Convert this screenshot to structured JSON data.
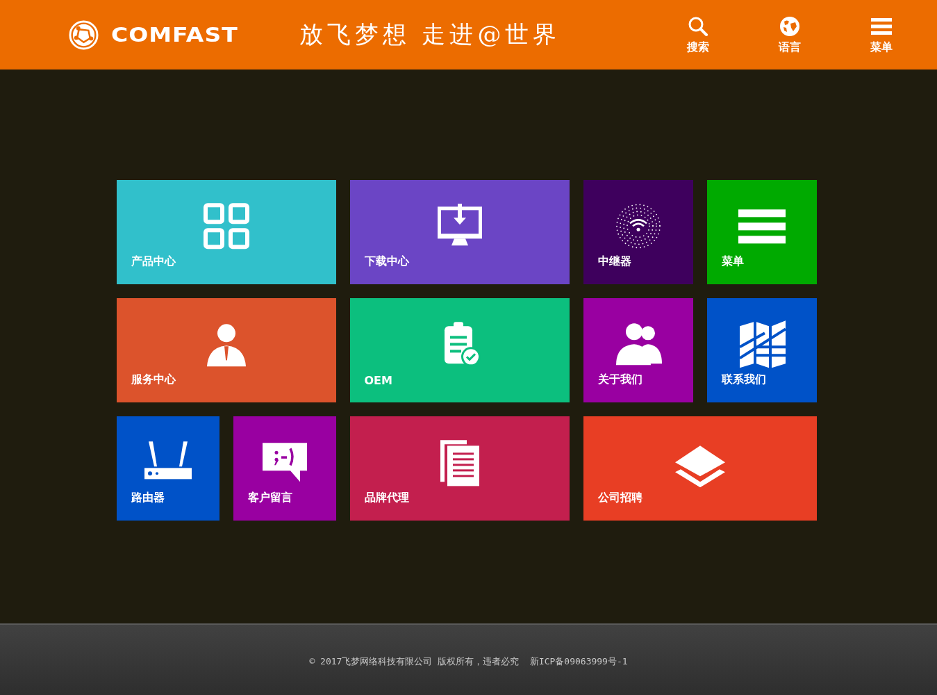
{
  "header": {
    "brand": "COMFAST",
    "slogan": "放飞梦想 走进@世界",
    "nav": [
      {
        "label": "搜索"
      },
      {
        "label": "语言"
      },
      {
        "label": "菜单"
      }
    ]
  },
  "tiles": [
    {
      "label": "产品中心",
      "kind": "wide",
      "color": "#31c0cb"
    },
    {
      "label": "下载中心",
      "kind": "wide",
      "color": "#6b45c5"
    },
    {
      "label": "中继器",
      "kind": "small",
      "color": "#3e005d"
    },
    {
      "label": "菜单",
      "kind": "small",
      "color": "#00aa00"
    },
    {
      "label": "服务中心",
      "kind": "wide",
      "color": "#dc532c"
    },
    {
      "label": "OEM",
      "kind": "wide",
      "color": "#0cbf7e"
    },
    {
      "label": "关于我们",
      "kind": "small",
      "color": "#9900a1"
    },
    {
      "label": "联系我们",
      "kind": "small",
      "color": "#0052c8"
    },
    {
      "label": "路由器",
      "kind": "small",
      "color": "#0052c8"
    },
    {
      "label": "客户留言",
      "kind": "small",
      "color": "#9900a1"
    },
    {
      "label": "品牌代理",
      "kind": "wide",
      "color": "#c31f4e"
    },
    {
      "label": "公司招聘",
      "kind": "wide",
      "color": "#e83e24"
    }
  ],
  "footer": {
    "text": "© 2017飞梦网络科技有限公司 版权所有，违者必究  新ICP备09063999号-1"
  }
}
